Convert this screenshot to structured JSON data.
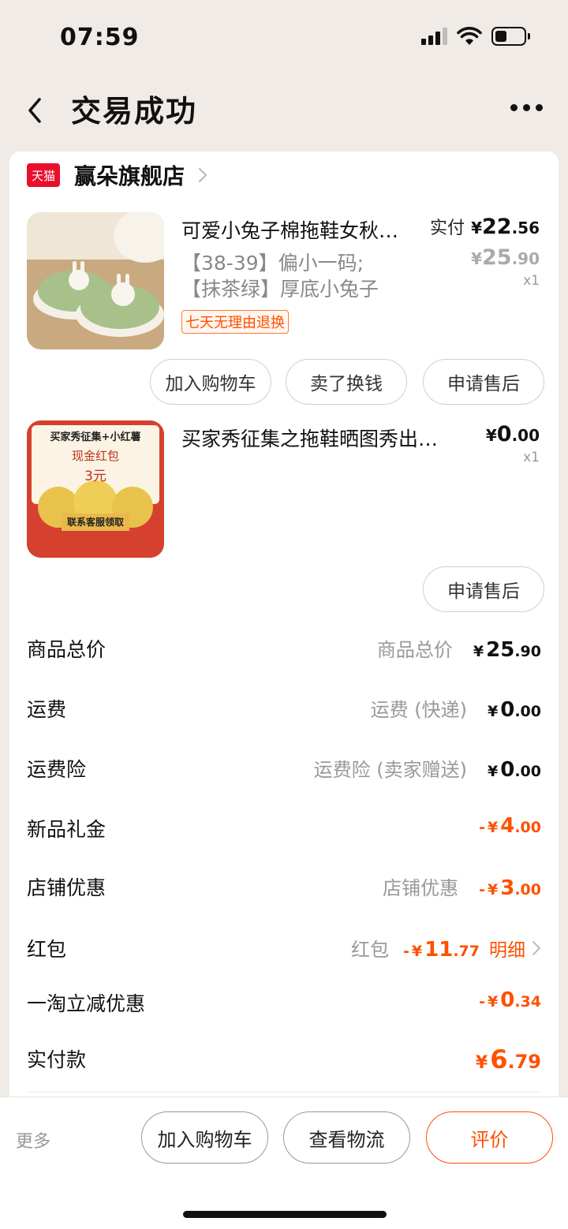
{
  "status": {
    "time": "07:59",
    "battery_level": 0.4
  },
  "nav": {
    "title": "交易成功"
  },
  "shop": {
    "badge": "天猫",
    "name": "赢朵旗舰店"
  },
  "products": [
    {
      "title": "可爱小兔子棉拖鞋女秋…",
      "spec_line1": "【38-39】偏小一码;",
      "spec_line2": "【抹茶绿】厚底小兔子",
      "tag": "七天无理由退换",
      "paid_label": "实付",
      "paid_int": "22",
      "paid_dec": ".56",
      "orig_int": "25",
      "orig_dec": ".90",
      "qty": "x1",
      "actions": [
        "加入购物车",
        "卖了换钱",
        "申请售后"
      ]
    },
    {
      "title": "买家秀征集之拖鞋晒图秀出…",
      "price_int": "0",
      "price_dec": ".00",
      "qty": "x1",
      "thumb_heading": "买家秀征集+小红薯",
      "thumb_line1": "现金红包",
      "thumb_line2": "3元",
      "thumb_button": "联系客服领取",
      "actions": [
        "申请售后"
      ]
    }
  ],
  "currency": "¥",
  "fees": {
    "goods_total": {
      "label": "商品总价",
      "sub": "商品总价",
      "int": "25",
      "dec": ".90"
    },
    "shipping": {
      "label": "运费",
      "sub": "运费 (快递)",
      "int": "0",
      "dec": ".00"
    },
    "shipping_insurance": {
      "label": "运费险",
      "sub": "运费险 (卖家赠送)",
      "int": "0",
      "dec": ".00"
    },
    "new_gift": {
      "label": "新品礼金",
      "prefix": "-",
      "int": "4",
      "dec": ".00"
    },
    "shop_discount": {
      "label": "店铺优惠",
      "sub": "店铺优惠",
      "prefix": "-",
      "int": "3",
      "dec": ".00"
    },
    "red_packet": {
      "label": "红包",
      "sub": "红包",
      "prefix": "-",
      "int": "11",
      "dec": ".77",
      "detail": "明细"
    },
    "taobao_discount": {
      "label": "一淘立减优惠",
      "prefix": "-",
      "int": "0",
      "dec": ".34"
    },
    "final": {
      "label": "实付款",
      "int": "6",
      "dec": ".79"
    }
  },
  "bottom": {
    "more": "更多",
    "add_cart": "加入购物车",
    "logistics": "查看物流",
    "review": "评价"
  },
  "colors": {
    "accent": "#ff5000",
    "tmall": "#e8102a",
    "background": "#f0ebe6"
  }
}
